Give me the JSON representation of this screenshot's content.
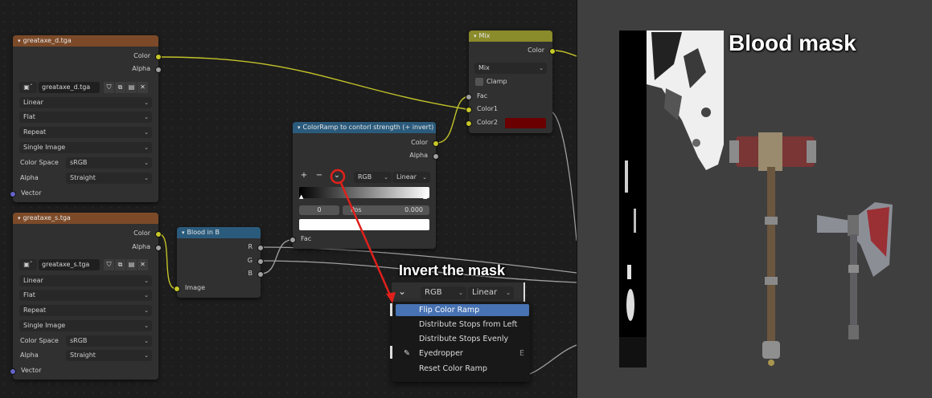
{
  "image_node_1": {
    "title": "greataxe_d.tga",
    "outputs": [
      "Color",
      "Alpha"
    ],
    "filename": "greataxe_d.tga",
    "interpolation": "Linear",
    "projection": "Flat",
    "extension": "Repeat",
    "source": "Single Image",
    "color_space_label": "Color Space",
    "color_space": "sRGB",
    "alpha_label": "Alpha",
    "alpha_mode": "Straight",
    "input": "Vector"
  },
  "image_node_2": {
    "title": "greataxe_s.tga",
    "outputs": [
      "Color",
      "Alpha"
    ],
    "filename": "greataxe_s.tga",
    "interpolation": "Linear",
    "projection": "Flat",
    "extension": "Repeat",
    "source": "Single Image",
    "color_space_label": "Color Space",
    "color_space": "sRGB",
    "alpha_label": "Alpha",
    "alpha_mode": "Straight",
    "input": "Vector"
  },
  "separate_node": {
    "title": "Blood in B",
    "outputs": [
      "R",
      "G",
      "B"
    ],
    "input": "Image"
  },
  "colorramp_node": {
    "title": "ColorRamp to contorl strength (+ invert)",
    "outputs": [
      "Color",
      "Alpha"
    ],
    "add": "+",
    "remove": "−",
    "color_mode": "RGB",
    "interpolation": "Linear",
    "stop_index": "0",
    "pos_label": "Pos",
    "pos_value": "0.000",
    "input": "Fac"
  },
  "mix_node": {
    "title": "Mix",
    "output": "Color",
    "blend": "Mix",
    "clamp_label": "Clamp",
    "inputs": [
      "Fac",
      "Color1",
      "Color2"
    ],
    "color2_hex": "#6b0000"
  },
  "zoom_panel": {
    "color_mode": "RGB",
    "interpolation": "Linear"
  },
  "context_menu": {
    "items": [
      {
        "label": "Flip Color Ramp",
        "shortcut": ""
      },
      {
        "label": "Distribute Stops from Left",
        "shortcut": ""
      },
      {
        "label": "Distribute Stops Evenly",
        "shortcut": ""
      },
      {
        "label": "Eyedropper",
        "shortcut": "E"
      },
      {
        "label": "Reset Color Ramp",
        "shortcut": ""
      }
    ]
  },
  "annotations": {
    "invert_caption": "Invert the mask",
    "viewport_caption": "Blood mask",
    "arrow_color": "#e0201b"
  },
  "colors": {
    "image_header": "#7c4a28",
    "converter_header": "#2b5b7c",
    "mix_header": "#8a8b2a",
    "menu_highlight": "#4772b3",
    "socket_color": "#c7c729",
    "socket_gray": "#a1a1a1",
    "socket_vector": "#6363c7"
  }
}
